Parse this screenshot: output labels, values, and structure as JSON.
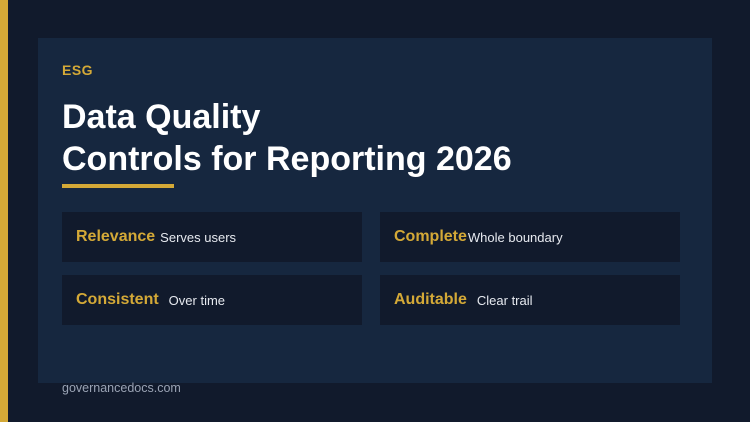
{
  "slide": {
    "eyebrow": "ESG",
    "title_line1": "Data Quality",
    "title_line2": "Controls for Reporting 2026",
    "cards": [
      {
        "key": "Relevance",
        "desc": "Serves users"
      },
      {
        "key": "Complete",
        "desc": "Whole boundary"
      },
      {
        "key": "Consistent",
        "desc": "Over time"
      },
      {
        "key": "Auditable",
        "desc": "Clear trail"
      }
    ],
    "footer": "governancedocs.com"
  },
  "colors": {
    "background": "#111a2c",
    "panel": "#16273f",
    "accent": "#d4a937",
    "title": "#ffffff",
    "footer_text": "#9aa3b4"
  }
}
